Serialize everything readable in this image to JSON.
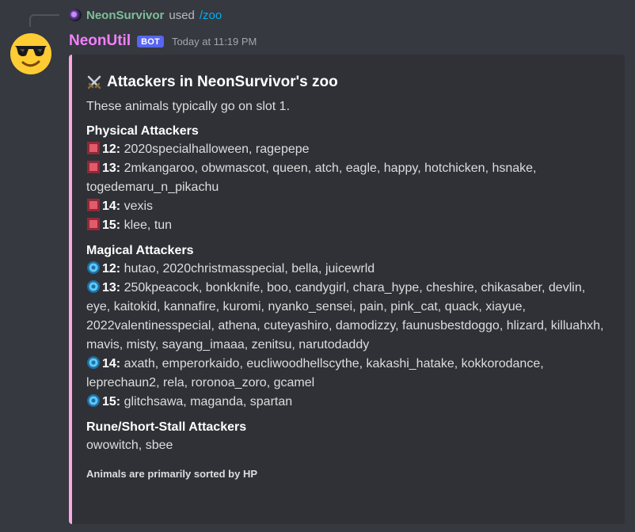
{
  "reply": {
    "user": "NeonSurvivor",
    "verb": "used",
    "command": "/zoo"
  },
  "message": {
    "username": "NeonUtil",
    "bot_tag": "BOT",
    "timestamp": "Today at 11:19 PM"
  },
  "embed": {
    "accent_color": "#ffa6e4",
    "title_icon": "crossed-swords-icon",
    "title": "Attackers in NeonSurvivor's zoo",
    "description": "These animals typically go on slot 1.",
    "fields": [
      {
        "name": "Physical Attackers",
        "icon": "red-square-icon",
        "rows": [
          {
            "level": "12:",
            "animals": "2020specialhalloween, ragepepe"
          },
          {
            "level": "13:",
            "animals": "2mkangaroo, obwmascot, queen, atch, eagle, happy, hotchicken, hsnake, togedemaru_n_pikachu"
          },
          {
            "level": "14:",
            "animals": "vexis"
          },
          {
            "level": "15:",
            "animals": "klee, tun"
          }
        ]
      },
      {
        "name": "Magical Attackers",
        "icon": "blue-gear-icon",
        "rows": [
          {
            "level": "12:",
            "animals": "hutao, 2020christmasspecial, bella, juicewrld"
          },
          {
            "level": "13:",
            "animals": "250kpeacock, bonkknife, boo, candygirl, chara_hype, cheshire, chikasaber, devlin, eye, kaitokid, kannafire, kuromi, nyanko_sensei, pain, pink_cat, quack, xiayue, 2022valentinesspecial, athena, cuteyashiro, damodizzy, faunusbestdoggo, hlizard, killuahxh, mavis, misty, sayang_imaaa, zenitsu, narutodaddy"
          },
          {
            "level": "14:",
            "animals": "axath, emperorkaido, eucliwoodhellscythe, kakashi_hatake, kokkorodance, leprechaun2, rela, roronoa_zoro, gcamel"
          },
          {
            "level": "15:",
            "animals": "glitchsawa, maganda, spartan"
          }
        ]
      },
      {
        "name": "Rune/Short-Stall Attackers",
        "text": "owowitch, sbee"
      }
    ],
    "footer": "Animals are primarily sorted by HP"
  }
}
